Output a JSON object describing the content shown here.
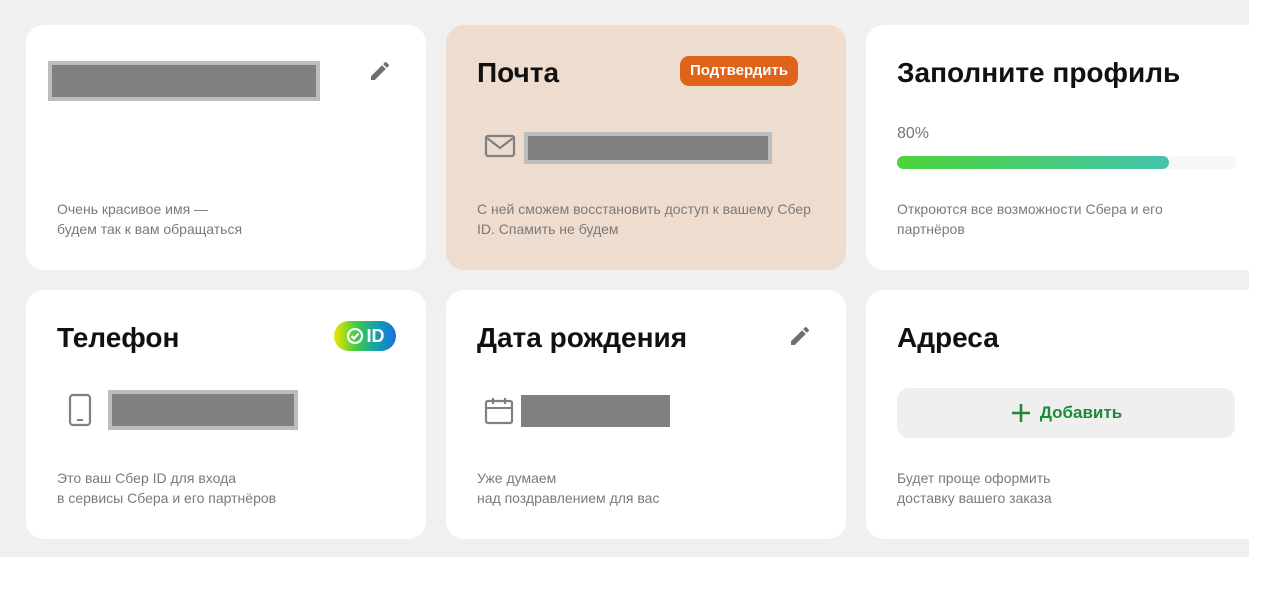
{
  "cards": {
    "name": {
      "description": "Очень красивое имя —\nбудем так к вам обращаться",
      "edit_icon": "pencil-icon"
    },
    "email": {
      "title": "Почта",
      "badge": "Подтвердить",
      "description": "С ней сможем восстановить доступ к вашему Сбер ID. Спамить не будем",
      "icon": "mail-icon"
    },
    "profile": {
      "title": "Заполните профиль",
      "progress_label": "80%",
      "progress_value": 0.8,
      "description": "Откроются все возможности Сбера и его партнёров"
    },
    "phone": {
      "title": "Телефон",
      "badge_label": "ID",
      "description": "Это ваш Сбер ID для входа\nв сервисы Сбера и его партнёров",
      "icon": "smartphone-icon"
    },
    "birthday": {
      "title": "Дата рождения",
      "description": "Уже думаем\nнад поздравлением для вас",
      "icon": "calendar-icon",
      "edit_icon": "pencil-icon"
    },
    "addresses": {
      "title": "Адреса",
      "add_label": "Добавить",
      "description": "Будет проще оформить\nдоставку вашего заказа"
    }
  },
  "colors": {
    "accent_orange": "#e0631b",
    "accent_green": "#1b8a3a",
    "peach_card": "#eedccf"
  }
}
